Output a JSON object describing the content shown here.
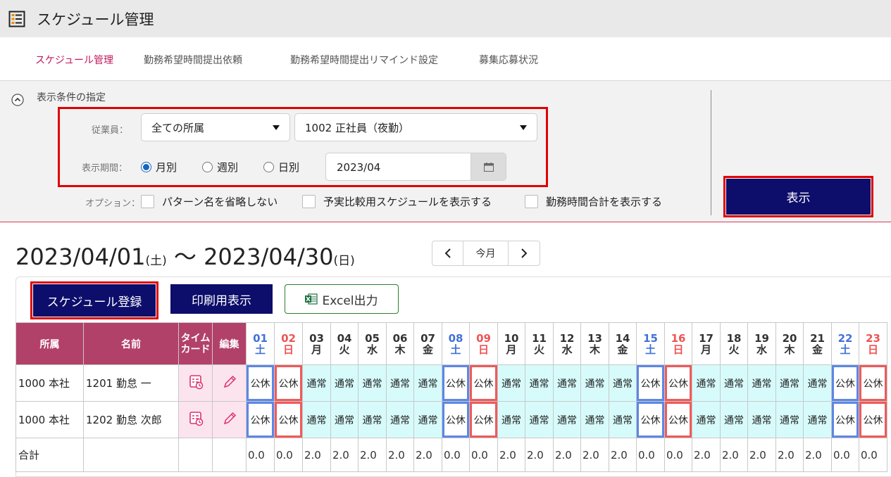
{
  "title": "スケジュール管理",
  "tabs": [
    {
      "label": "スケジュール管理",
      "active": true
    },
    {
      "label": "勤務希望時間提出依頼"
    },
    {
      "label": "勤務希望時間提出リマインド設定"
    },
    {
      "label": "募集応募状況"
    }
  ],
  "filter": {
    "section_label": "表示条件の指定",
    "employee_label": "従業員：",
    "department": "全ての所属",
    "employee": "1002 正社員（夜勤）",
    "period_label": "表示期間：",
    "period_options": [
      "月別",
      "週別",
      "日別"
    ],
    "period_selected": "月別",
    "date": "2023/04",
    "options_label": "オプション：",
    "options": [
      "パターン名を省略しない",
      "予実比較用スケジュールを表示する",
      "勤務時間合計を表示する"
    ],
    "show_button": "表示"
  },
  "range": {
    "start": "2023/04/01",
    "start_dow": "(土)",
    "sep": "〜",
    "end": "2023/04/30",
    "end_dow": "(日)"
  },
  "nav": {
    "prev": "<",
    "current": "今月",
    "next": ">"
  },
  "actions": {
    "register": "スケジュール登録",
    "print": "印刷用表示",
    "excel": "Excel出力"
  },
  "table": {
    "headers": {
      "dept": "所属",
      "name": "名前",
      "timecard": "タイムカード",
      "edit": "編集"
    },
    "days": [
      {
        "d": "01",
        "w": "土",
        "t": "sat"
      },
      {
        "d": "02",
        "w": "日",
        "t": "sun"
      },
      {
        "d": "03",
        "w": "月",
        "t": "wd"
      },
      {
        "d": "04",
        "w": "火",
        "t": "wd"
      },
      {
        "d": "05",
        "w": "水",
        "t": "wd"
      },
      {
        "d": "06",
        "w": "木",
        "t": "wd"
      },
      {
        "d": "07",
        "w": "金",
        "t": "wd"
      },
      {
        "d": "08",
        "w": "土",
        "t": "sat"
      },
      {
        "d": "09",
        "w": "日",
        "t": "sun"
      },
      {
        "d": "10",
        "w": "月",
        "t": "wd"
      },
      {
        "d": "11",
        "w": "火",
        "t": "wd"
      },
      {
        "d": "12",
        "w": "水",
        "t": "wd"
      },
      {
        "d": "13",
        "w": "木",
        "t": "wd"
      },
      {
        "d": "14",
        "w": "金",
        "t": "wd"
      },
      {
        "d": "15",
        "w": "土",
        "t": "sat"
      },
      {
        "d": "16",
        "w": "日",
        "t": "sun"
      },
      {
        "d": "17",
        "w": "月",
        "t": "wd"
      },
      {
        "d": "18",
        "w": "火",
        "t": "wd"
      },
      {
        "d": "19",
        "w": "水",
        "t": "wd"
      },
      {
        "d": "20",
        "w": "木",
        "t": "wd"
      },
      {
        "d": "21",
        "w": "金",
        "t": "wd"
      },
      {
        "d": "22",
        "w": "土",
        "t": "sat"
      },
      {
        "d": "23",
        "w": "日",
        "t": "sun"
      }
    ],
    "rows": [
      {
        "dept": "1000 本社",
        "name": "1201 勤怠 一",
        "cells": [
          "公休",
          "公休",
          "通常",
          "通常",
          "通常",
          "通常",
          "通常",
          "公休",
          "公休",
          "通常",
          "通常",
          "通常",
          "通常",
          "通常",
          "公休",
          "公休",
          "通常",
          "通常",
          "通常",
          "通常",
          "通常",
          "公休",
          "公休"
        ]
      },
      {
        "dept": "1000 本社",
        "name": "1202 勤怠 次郎",
        "cells": [
          "公休",
          "公休",
          "通常",
          "通常",
          "通常",
          "通常",
          "通常",
          "公休",
          "公休",
          "通常",
          "通常",
          "通常",
          "通常",
          "通常",
          "公休",
          "公休",
          "通常",
          "通常",
          "通常",
          "通常",
          "通常",
          "公休",
          "公休"
        ]
      }
    ],
    "total_label": "合計",
    "totals": [
      "0.0",
      "0.0",
      "2.0",
      "2.0",
      "2.0",
      "2.0",
      "2.0",
      "0.0",
      "0.0",
      "2.0",
      "2.0",
      "2.0",
      "2.0",
      "2.0",
      "0.0",
      "0.0",
      "2.0",
      "2.0",
      "2.0",
      "2.0",
      "2.0",
      "0.0",
      "0.0"
    ]
  },
  "colors": {
    "accent": "#c2185b",
    "navy": "#0d0d6b",
    "header_bg": "#b2416a",
    "saturday": "#4171d8",
    "sunday": "#ef5353",
    "workday_cell": "#d7fbfb",
    "highlight": "#e00000"
  }
}
